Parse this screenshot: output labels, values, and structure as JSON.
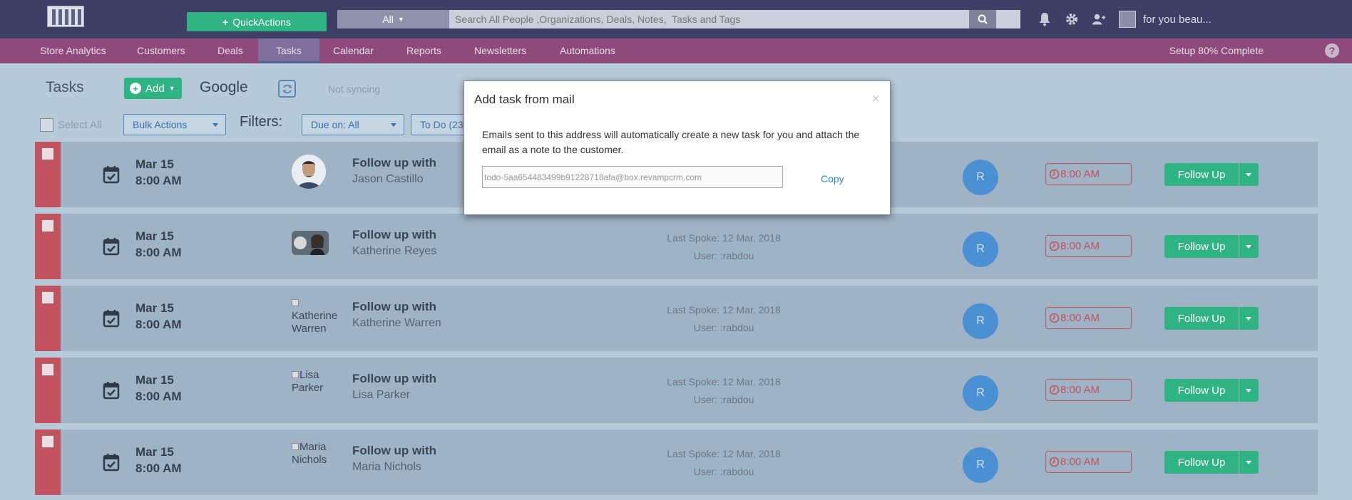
{
  "topbar": {
    "quick_actions": "QuickActions",
    "search_scope": "All",
    "search_placeholder": "Search All People ,Organizations, Deals, Notes,  Tasks and Tags",
    "username": "for you beau..."
  },
  "nav": {
    "items": [
      "Store Analytics",
      "Customers",
      "Deals",
      "Tasks",
      "Calendar",
      "Reports",
      "Newsletters",
      "Automations"
    ],
    "active": "Tasks",
    "setup": "Setup 80% Complete"
  },
  "toolbar": {
    "title": "Tasks",
    "add": "Add",
    "google": "Google",
    "sync_status": "Not syncing",
    "select_all": "Select All",
    "bulk_actions": "Bulk Actions",
    "filters": "Filters:",
    "due_on": "Due on: All",
    "todo": "To Do (23)"
  },
  "rows": [
    {
      "date": "Mar 15",
      "time": "8:00 AM",
      "title": "Follow up with",
      "name": "Jason Castillo",
      "photo_alt": "",
      "spoke": "",
      "user": "",
      "initial": "R",
      "reminder": "8:00 AM",
      "action": "Follow Up"
    },
    {
      "date": "Mar 15",
      "time": "8:00 AM",
      "title": "Follow up with",
      "name": "Katherine Reyes",
      "photo_alt": "",
      "spoke": "Last Spoke: 12 Mar, 2018",
      "user": "User: :rabdou",
      "initial": "R",
      "reminder": "8:00 AM",
      "action": "Follow Up"
    },
    {
      "date": "Mar 15",
      "time": "8:00 AM",
      "title": "Follow up with",
      "name": "Katherine Warren",
      "photo_alt": "Katherine Warren",
      "spoke": "Last Spoke: 12 Mar, 2018",
      "user": "User: :rabdou",
      "initial": "R",
      "reminder": "8:00 AM",
      "action": "Follow Up"
    },
    {
      "date": "Mar 15",
      "time": "8:00 AM",
      "title": "Follow up with",
      "name": "Lisa Parker",
      "photo_alt": "Lisa Parker",
      "spoke": "Last Spoke: 12 Mar, 2018",
      "user": "User: :rabdou",
      "initial": "R",
      "reminder": "8:00 AM",
      "action": "Follow Up"
    },
    {
      "date": "Mar 15",
      "time": "8:00 AM",
      "title": "Follow up with",
      "name": "Maria Nichols",
      "photo_alt": "Maria Nichols",
      "spoke": "Last Spoke: 12 Mar, 2018",
      "user": "User: :rabdou",
      "initial": "R",
      "reminder": "8:00 AM",
      "action": "Follow Up"
    }
  ],
  "modal": {
    "title": "Add task from mail",
    "close": "×",
    "text": "Emails sent to this address will automatically create a new task for you and attach the email as a note to the customer.",
    "email": "todo-5aa654483499b91228718afa@box.revampcrm.com",
    "copy": "Copy"
  },
  "colors": {
    "topbar": "#3e3f66",
    "navbar": "#8e4a7a",
    "accent_green": "#2fb383",
    "row_strip": "#c2525d",
    "avatar_blue": "#4a90d2"
  }
}
